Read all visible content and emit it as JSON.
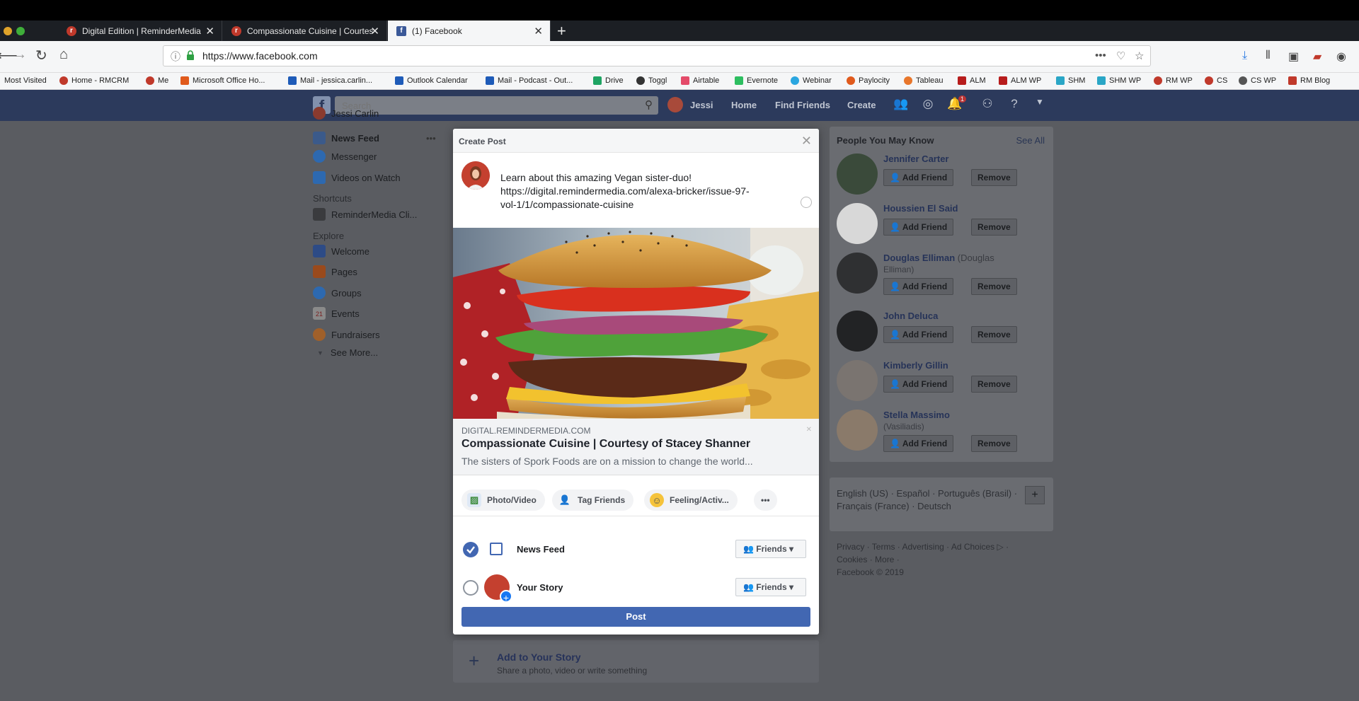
{
  "browser": {
    "tabs": [
      {
        "label": "Digital Edition | ReminderMedia",
        "icon_color": "#c0392b"
      },
      {
        "label": "Compassionate Cuisine | Courtesy",
        "icon_color": "#c0392b"
      },
      {
        "label": "(1) Facebook",
        "icon_color": "#3b5998"
      }
    ],
    "new_tab": "+",
    "url": "https://www.facebook.com",
    "bookmarks": [
      {
        "label": "Most Visited",
        "color": ""
      },
      {
        "label": "Home - RMCRM",
        "color": "#c0392b"
      },
      {
        "label": "Me",
        "color": "#c0392b"
      },
      {
        "label": "Microsoft Office Ho...",
        "color": "#e05a1c"
      },
      {
        "label": "Mail - jessica.carlin...",
        "color": "#1e5bb8"
      },
      {
        "label": "Outlook Calendar",
        "color": "#1e5bb8"
      },
      {
        "label": "Mail - Podcast - Out...",
        "color": "#1e5bb8"
      },
      {
        "label": "Drive",
        "color": "#1fa463"
      },
      {
        "label": "Toggl",
        "color": "#333333"
      },
      {
        "label": "Airtable",
        "color": "#e44b6a"
      },
      {
        "label": "Evernote",
        "color": "#2dbe60"
      },
      {
        "label": "Webinar",
        "color": "#2aa6e0"
      },
      {
        "label": "Paylocity",
        "color": "#e05a1c"
      },
      {
        "label": "Tableau",
        "color": "#e8762b"
      },
      {
        "label": "ALM",
        "color": "#b71c1c"
      },
      {
        "label": "ALM WP",
        "color": "#b71c1c"
      },
      {
        "label": "SHM",
        "color": "#2aa6c6"
      },
      {
        "label": "SHM WP",
        "color": "#2aa6c6"
      },
      {
        "label": "RM WP",
        "color": "#c0392b"
      },
      {
        "label": "CS",
        "color": "#c0392b"
      },
      {
        "label": "CS WP",
        "color": "#555555"
      },
      {
        "label": "RM Blog",
        "color": "#c0392b"
      }
    ]
  },
  "facebook": {
    "search_placeholder": "Search",
    "user_name": "Jessi",
    "nav": [
      "Home",
      "Find Friends",
      "Create"
    ],
    "notification_count": "1",
    "sidebar": {
      "profile": "Jessi Carlin",
      "items": [
        "News Feed",
        "Messenger",
        "Videos on Watch"
      ],
      "more_dots": "•••",
      "shortcuts_title": "Shortcuts",
      "shortcuts": [
        "ReminderMedia Cli..."
      ],
      "explore_title": "Explore",
      "explore": [
        "Welcome",
        "Pages",
        "Groups",
        "Events",
        "Fundraisers"
      ],
      "events_day": "21",
      "see_more": "See More..."
    },
    "pymk": {
      "title": "People You May Know",
      "see_all": "See All",
      "add_label": "Add Friend",
      "remove_label": "Remove",
      "people": [
        {
          "name": "Jennifer Carter",
          "sub": ""
        },
        {
          "name": "Houssien El Said",
          "sub": ""
        },
        {
          "name": "Douglas Elliman",
          "sub": "(Douglas",
          "sub2": "Elliman)"
        },
        {
          "name": "John Deluca",
          "sub": ""
        },
        {
          "name": "Kimberly Gillin",
          "sub": ""
        },
        {
          "name": "Stella Massimo",
          "sub": "",
          "sub2": "(Vasiliadis)"
        }
      ]
    },
    "languages": "English (US) · Español · Português (Brasil) · Français (France) · Deutsch",
    "lang_plus": "+",
    "footer_line1": "Privacy · Terms · Advertising · Ad Choices ▷ ·",
    "footer_line2": "Cookies · More ·",
    "footer_line3": "Facebook © 2019",
    "add_story": {
      "title": "Add to Your Story",
      "subtitle": "Share a photo, video or write something",
      "plus": "+"
    }
  },
  "modal": {
    "title": "Create Post",
    "close": "✕",
    "post_text": "Learn about this amazing Vegan sister-duo!\nhttps://digital.remindermedia.com/alexa-bricker/issue-97-\nvol-1/1/compassionate-cuisine",
    "link_domain": "DIGITAL.REMINDERMEDIA.COM",
    "link_title": "Compassionate Cuisine | Courtesy of Stacey Shanner",
    "link_desc": "The sisters of Spork Foods are on a mission to change the world...",
    "actions": [
      "Photo/Video",
      "Tag Friends",
      "Feeling/Activ...",
      "•••"
    ],
    "destinations": [
      {
        "label": "News Feed",
        "audience": "Friends",
        "checked": true
      },
      {
        "label": "Your Story",
        "audience": "Friends",
        "checked": false
      }
    ],
    "post_button": "Post"
  }
}
